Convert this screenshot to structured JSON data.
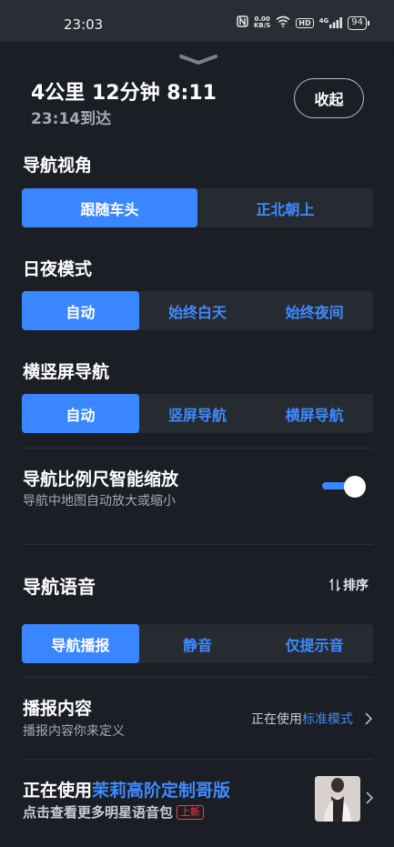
{
  "status_bar": {
    "time": "23:03",
    "net_speed_value": "0.00",
    "net_speed_unit": "KB/S",
    "hd_label": "HD",
    "signal_label": "4G",
    "battery": "94"
  },
  "header": {
    "eta_summary": "4公里 12分钟 8:11",
    "arrival": "23:14到达",
    "collapse_label": "收起"
  },
  "nav_view": {
    "title": "导航视角",
    "options": [
      "跟随车头",
      "正北朝上"
    ],
    "selected": "跟随车头"
  },
  "day_night": {
    "title": "日夜模式",
    "options": [
      "自动",
      "始终白天",
      "始终夜间"
    ],
    "selected": "自动"
  },
  "orientation": {
    "title": "横竖屏导航",
    "options": [
      "自动",
      "竖屏导航",
      "横屏导航"
    ],
    "selected": "自动"
  },
  "smart_zoom": {
    "title": "导航比例尺智能缩放",
    "subtitle": "导航中地图自动放大或缩小",
    "enabled": true
  },
  "voice": {
    "title": "导航语音",
    "sort_label": "排序",
    "options": [
      "导航播报",
      "静音",
      "仅提示音"
    ],
    "selected": "导航播报"
  },
  "broadcast_content": {
    "title": "播报内容",
    "subtitle": "播报内容你来定义",
    "status_prefix": "正在使用",
    "status_value": "标准模式"
  },
  "voice_pack": {
    "prefix": "正在使用",
    "name": "茉莉高阶定制哥版",
    "subtitle": "点击查看更多明星语音包",
    "badge": "上新"
  },
  "colors": {
    "accent": "#3a86ff",
    "background": "#1b1e24",
    "segment_bg": "#262a31",
    "badge_red": "#ff3b3b"
  }
}
